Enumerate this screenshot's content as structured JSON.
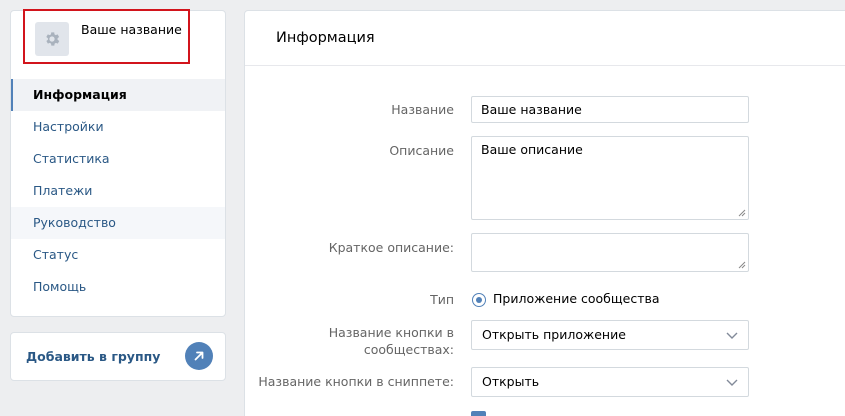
{
  "app": {
    "name": "Ваше название",
    "icon": "gear-icon"
  },
  "sidebar": {
    "items": [
      {
        "label": "Информация",
        "active": true
      },
      {
        "label": "Настройки"
      },
      {
        "label": "Статистика"
      },
      {
        "label": "Платежи"
      },
      {
        "label": "Руководство"
      },
      {
        "label": "Статус"
      },
      {
        "label": "Помощь"
      }
    ],
    "add_to_group": "Добавить в группу",
    "add_icon": "arrow-up-right-icon"
  },
  "main": {
    "title": "Информация",
    "fields": {
      "name_label": "Название",
      "name_value": "Ваше название",
      "description_label": "Описание",
      "description_value": "Ваше описание",
      "short_description_label": "Краткое описание:",
      "short_description_value": "",
      "type_label": "Тип",
      "type_value": "Приложение сообщества",
      "button_name_label_line1": "Название кнопки в",
      "button_name_label_line2": "сообществах:",
      "button_name_value": "Открыть приложение",
      "snippet_button_label": "Название кнопки в сниппете:",
      "snippet_button_value": "Открыть"
    }
  },
  "colors": {
    "accent": "#5181b8",
    "link": "#2a5885",
    "highlight": "#d2141c",
    "background": "#edeef0"
  }
}
